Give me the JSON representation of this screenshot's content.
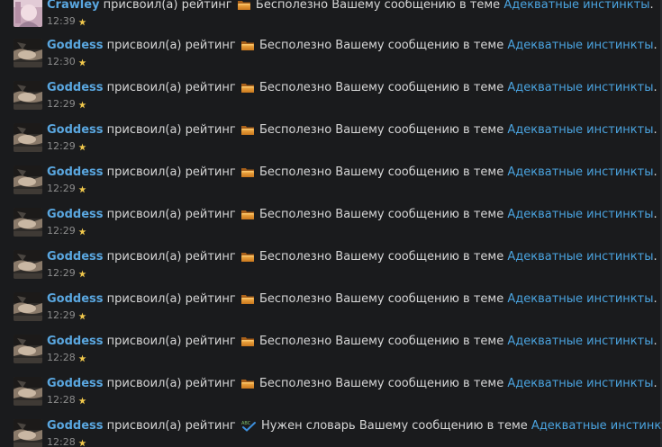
{
  "text": {
    "action": "присвоил(а) рейтинг",
    "message_prefix": "Вашему сообщению в теме",
    "thread_title": "Адекватные инстинкты",
    "period": "."
  },
  "colors": {
    "background": "#1a1b1d",
    "username": "#5aa7e0",
    "link": "#4aa3df",
    "text": "#d6d6d6",
    "timestamp": "#8c8c8c",
    "star": "#f2c94c"
  },
  "notifications": [
    {
      "user": "Crawley",
      "rating": "Бесполезно",
      "rating_icon": "folder-icon",
      "time": "12:39",
      "avatar": "crawley-avatar"
    },
    {
      "user": "Goddess",
      "rating": "Бесполезно",
      "rating_icon": "folder-icon",
      "time": "12:30",
      "avatar": "goddess-avatar"
    },
    {
      "user": "Goddess",
      "rating": "Бесполезно",
      "rating_icon": "folder-icon",
      "time": "12:29",
      "avatar": "goddess-avatar"
    },
    {
      "user": "Goddess",
      "rating": "Бесполезно",
      "rating_icon": "folder-icon",
      "time": "12:29",
      "avatar": "goddess-avatar"
    },
    {
      "user": "Goddess",
      "rating": "Бесполезно",
      "rating_icon": "folder-icon",
      "time": "12:29",
      "avatar": "goddess-avatar"
    },
    {
      "user": "Goddess",
      "rating": "Бесполезно",
      "rating_icon": "folder-icon",
      "time": "12:29",
      "avatar": "goddess-avatar"
    },
    {
      "user": "Goddess",
      "rating": "Бесполезно",
      "rating_icon": "folder-icon",
      "time": "12:29",
      "avatar": "goddess-avatar"
    },
    {
      "user": "Goddess",
      "rating": "Бесполезно",
      "rating_icon": "folder-icon",
      "time": "12:29",
      "avatar": "goddess-avatar"
    },
    {
      "user": "Goddess",
      "rating": "Бесполезно",
      "rating_icon": "folder-icon",
      "time": "12:28",
      "avatar": "goddess-avatar"
    },
    {
      "user": "Goddess",
      "rating": "Бесполезно",
      "rating_icon": "folder-icon",
      "time": "12:28",
      "avatar": "goddess-avatar"
    },
    {
      "user": "Goddess",
      "rating": "Нужен словарь",
      "rating_icon": "abc-check-icon",
      "time": "12:28",
      "avatar": "goddess-avatar"
    }
  ]
}
